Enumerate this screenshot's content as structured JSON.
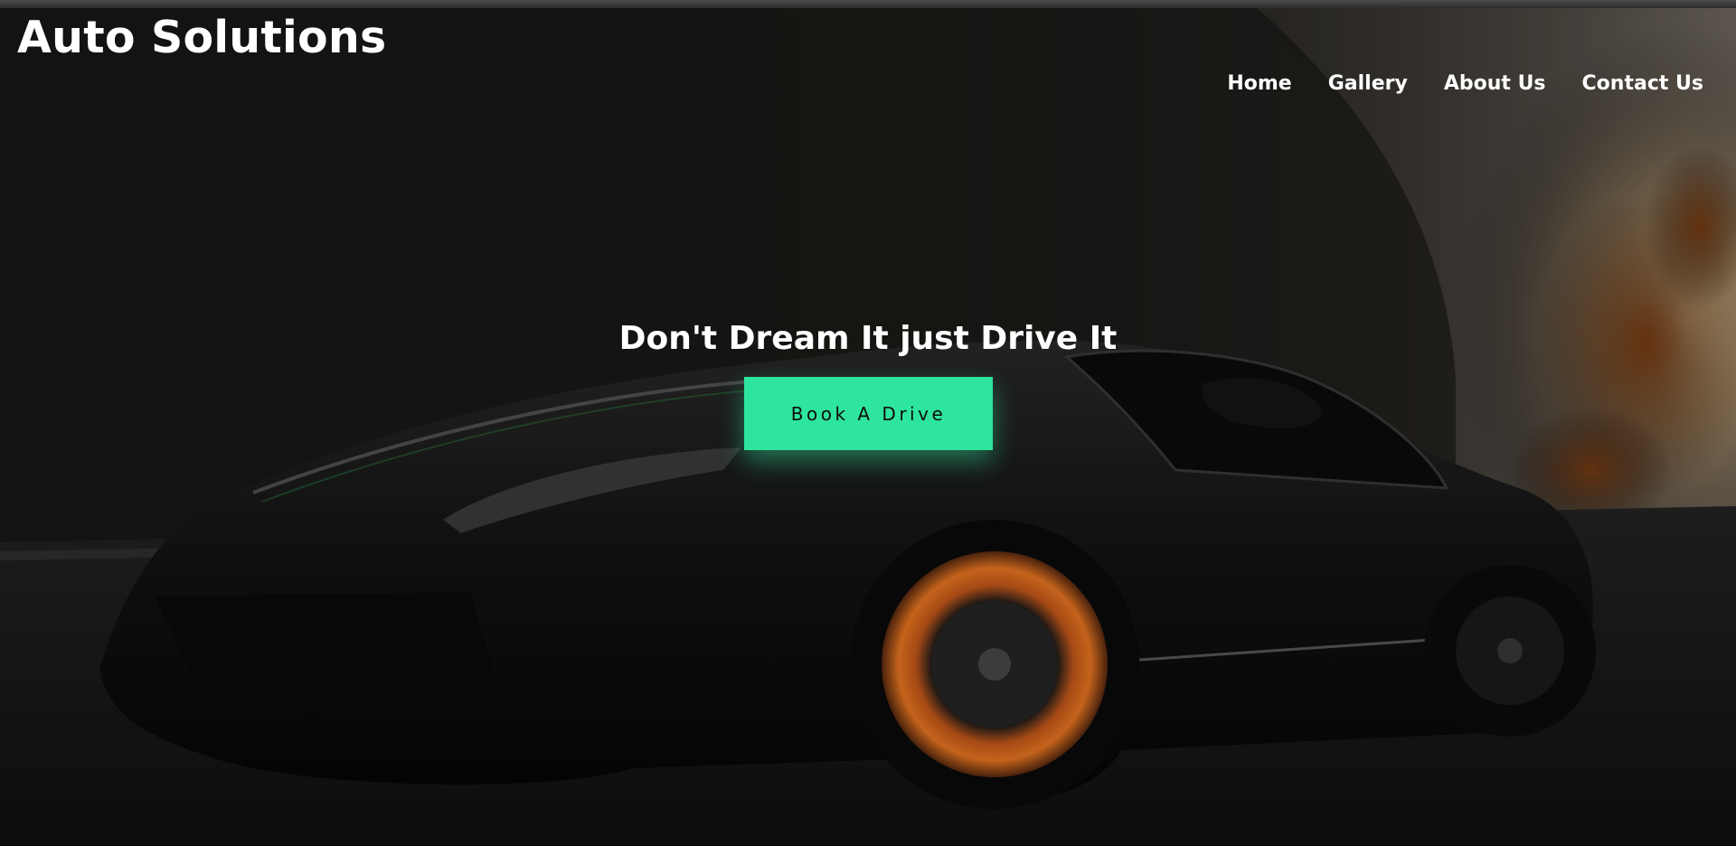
{
  "brand": {
    "title": "Auto Solutions"
  },
  "nav": {
    "items": [
      {
        "label": "Home"
      },
      {
        "label": "Gallery"
      },
      {
        "label": "About Us"
      },
      {
        "label": "Contact Us"
      }
    ]
  },
  "hero": {
    "headline": "Don't Dream It just Drive It",
    "cta_label": "Book A Drive",
    "background": "black-sports-car-photo",
    "accent_color": "#2ee59d"
  }
}
